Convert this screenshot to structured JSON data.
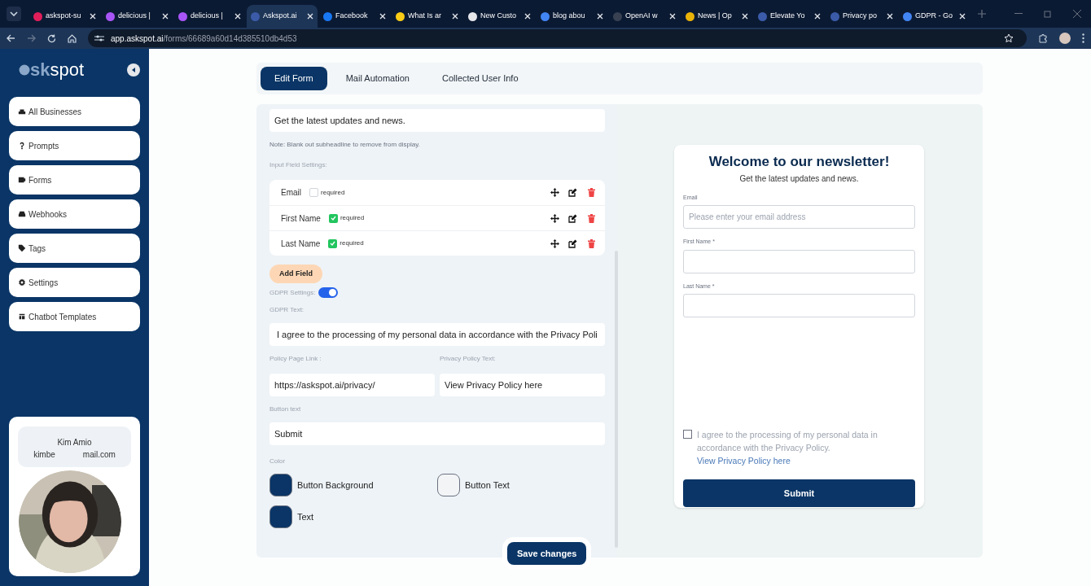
{
  "browser": {
    "tabs": [
      {
        "title": "askspot-su",
        "selected": false
      },
      {
        "title": "delicious |",
        "selected": false
      },
      {
        "title": "delicious |",
        "selected": false
      },
      {
        "title": "Askspot.ai",
        "selected": true
      },
      {
        "title": "Facebook",
        "selected": false
      },
      {
        "title": "What Is ar",
        "selected": false
      },
      {
        "title": "New Custo",
        "selected": false
      },
      {
        "title": "blog abou",
        "selected": false
      },
      {
        "title": "OpenAI w",
        "selected": false
      },
      {
        "title": "News | Op",
        "selected": false
      },
      {
        "title": "Elevate Yo",
        "selected": false
      },
      {
        "title": "Privacy po",
        "selected": false
      },
      {
        "title": "GDPR - Go",
        "selected": false
      }
    ],
    "url_host": "app.askspot.ai",
    "url_path": "/forms/66689a60d14d385510db4d53"
  },
  "sidebar": {
    "logo_a": "sk",
    "logo_b": "spot",
    "items": [
      "All Businesses",
      "Prompts",
      "Forms",
      "Webhooks",
      "Tags",
      "Settings",
      "Chatbot Templates"
    ],
    "user": {
      "name": "Kim Amio",
      "email_start": "kimbe",
      "email_end": "mail.com"
    }
  },
  "tabs": [
    {
      "label": "Edit Form",
      "selected": true
    },
    {
      "label": "Mail Automation",
      "selected": false
    },
    {
      "label": "Collected User Info",
      "selected": false
    }
  ],
  "editor": {
    "subheadline": "Get the latest updates and news.",
    "note": "Note: Blank out subheadline to remove from display.",
    "fields_label": "Input Field Settings:",
    "fields": [
      {
        "name": "Email",
        "required": false,
        "req_label": "required"
      },
      {
        "name": "First Name",
        "required": true,
        "req_label": "required"
      },
      {
        "name": "Last Name",
        "required": true,
        "req_label": "required"
      }
    ],
    "add_field": "Add Field",
    "gdpr_label": "GDPR Settings:",
    "gdpr_on": true,
    "gdpr_text_label": "GDPR Text:",
    "gdpr_text": "I agree to the processing of my personal data in accordance with the Privacy Poli",
    "policy_link_label": "Policy Page Link :",
    "policy_link": "https://askspot.ai/privacy/",
    "policy_text_label": "Privacy Policy Text:",
    "policy_text": "View Privacy Policy here",
    "button_text_label": "Button text",
    "button_text": "Submit",
    "color_label": "Color",
    "colors": [
      {
        "label": "Button Background",
        "color": "#0a3566"
      },
      {
        "label": "Button Text",
        "color": "#f3f4f6"
      },
      {
        "label": "Text",
        "color": "#0a3566"
      }
    ],
    "save": "Save changes"
  },
  "preview": {
    "title": "Welcome to our newsletter!",
    "subtitle": "Get the latest updates and news.",
    "fields": [
      {
        "label": "Email",
        "placeholder": "Please enter your email address"
      },
      {
        "label": "First Name *"
      },
      {
        "label": "Last Name *"
      }
    ],
    "consent": "I agree to the processing of my personal data in accordance with the Privacy Policy.",
    "checked": false,
    "link": "View Privacy Policy here",
    "submit": "Submit"
  }
}
